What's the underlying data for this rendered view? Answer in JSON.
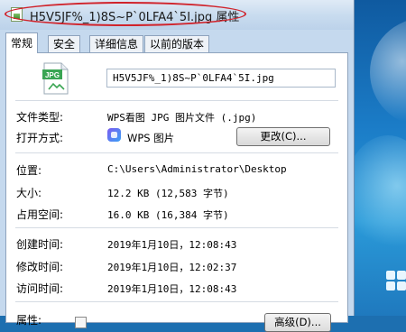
{
  "window": {
    "title": "H5V5JF%_1)8S~P`0LFA4`5I.jpg 属性"
  },
  "tabs": [
    {
      "label": "常规",
      "active": true
    },
    {
      "label": "安全",
      "active": false
    },
    {
      "label": "详细信息",
      "active": false
    },
    {
      "label": "以前的版本",
      "active": false
    }
  ],
  "general": {
    "file_icon": "jpg-file-icon",
    "file_icon_text": "JPG",
    "file_name": "H5V5JF%_1)8S~P`0LFA4`5I.jpg",
    "file_type_label": "文件类型:",
    "file_type_value": "WPS看图 JPG 图片文件 (.jpg)",
    "open_with_label": "打开方式:",
    "open_with_value": "WPS 图片",
    "change_button": "更改(C)...",
    "location_label": "位置:",
    "location_value": "C:\\Users\\Administrator\\Desktop",
    "size_label": "大小:",
    "size_value": "12.2 KB (12,583 字节)",
    "disk_size_label": "占用空间:",
    "disk_size_value": "16.0 KB (16,384 字节)",
    "created_label": "创建时间:",
    "created_value": "2019年1月10日，12:08:43",
    "modified_label": "修改时间:",
    "modified_value": "2019年1月10日，12:02:37",
    "accessed_label": "访问时间:",
    "accessed_value": "2019年1月10日，12:08:43",
    "attributes_label": "属性:",
    "advanced_button": "高级(D)..."
  },
  "colors": {
    "highlight_ellipse": "#d0232b",
    "desktop_blue": "#1b7cc7"
  }
}
